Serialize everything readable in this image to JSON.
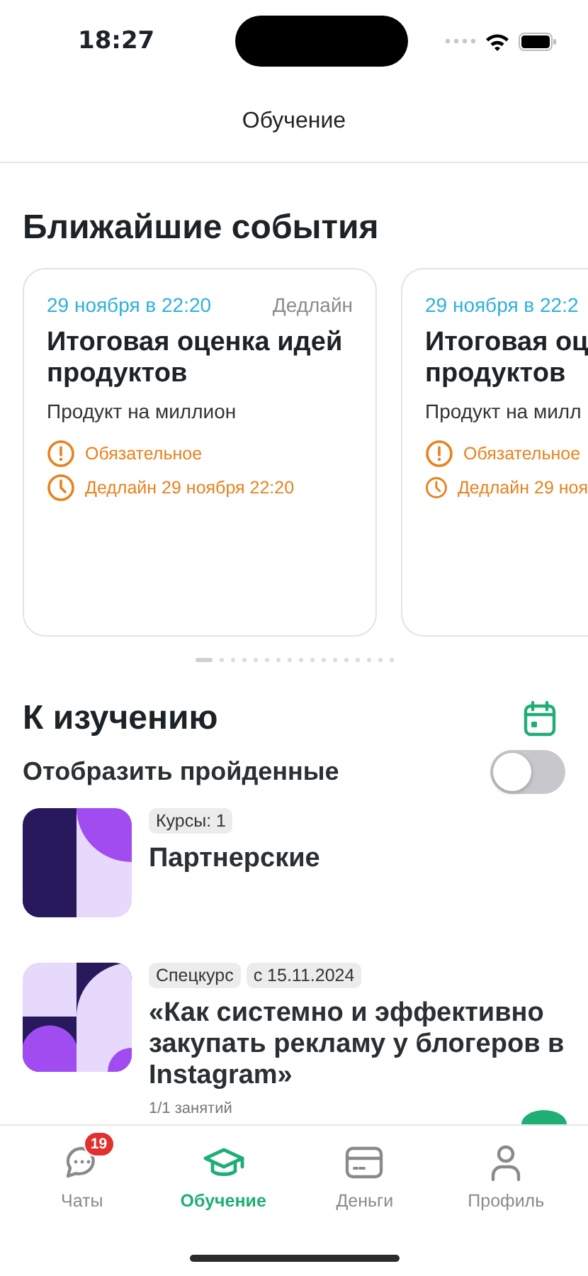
{
  "status_bar": {
    "time": "18:27"
  },
  "header": {
    "title": "Обучение"
  },
  "events": {
    "title": "Ближайшие события",
    "cards": [
      {
        "date": "29 ноября в 22:20",
        "tag": "Дедлайн",
        "title": "Итоговая оценка идей продуктов",
        "subtitle": "Продукт на миллион",
        "required": "Обязательное",
        "deadline": "Дедлайн 29 ноября 22:20",
        "partial": false
      },
      {
        "date": "29 ноября в 22:2",
        "title": "Итоговая оц продуктов",
        "subtitle": "Продукт на милл",
        "required": "Обязательное",
        "deadline": "Дедлайн 29 ноя",
        "partial": true
      }
    ],
    "pager": [
      {
        "selected": true
      },
      {
        "selected": false
      },
      {
        "selected": false
      },
      {
        "selected": false
      },
      {
        "selected": false
      },
      {
        "selected": false
      },
      {
        "selected": false
      },
      {
        "selected": false
      },
      {
        "selected": false
      },
      {
        "selected": false
      },
      {
        "selected": false
      },
      {
        "selected": false
      },
      {
        "selected": false
      },
      {
        "selected": false
      },
      {
        "selected": false
      },
      {
        "selected": false
      },
      {
        "selected": false
      }
    ]
  },
  "study": {
    "title": "К изучению",
    "toggle_label": "Отобразить пройденные",
    "show_completed": false,
    "items": [
      {
        "kind": "course",
        "tags": [
          "Курсы: 1"
        ],
        "title": "Партнерские"
      },
      {
        "kind": "special",
        "tags": [
          "Спецкурс",
          "с 15.11.2024"
        ],
        "title": "«Как системно и эффективно закупать рекламу у блогеров в Instagram»",
        "progress": "1/1 занятий"
      }
    ]
  },
  "tab_bar": [
    {
      "kind": "chat",
      "label": "Чаты",
      "badge": "19",
      "selected": false
    },
    {
      "kind": "learn",
      "label": "Обучение",
      "selected": true
    },
    {
      "kind": "money",
      "label": "Деньги",
      "selected": false
    },
    {
      "kind": "profile",
      "label": "Профиль",
      "selected": false
    }
  ]
}
